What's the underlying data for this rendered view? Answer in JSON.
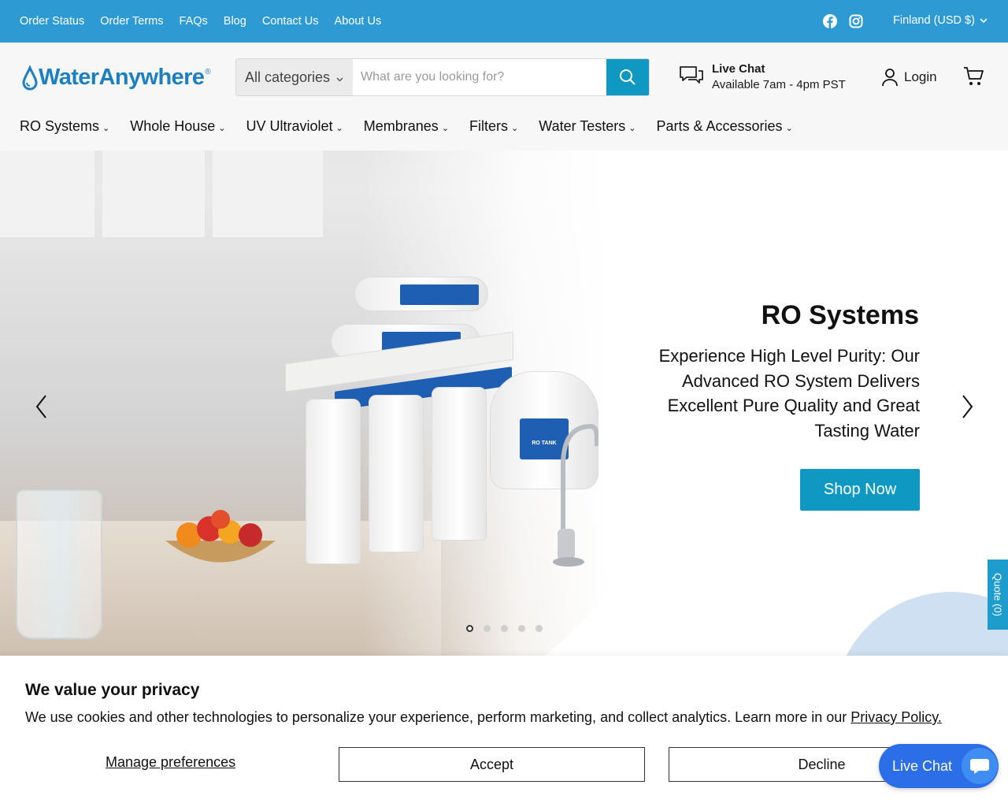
{
  "topbar": {
    "links": [
      "Order Status",
      "Order Terms",
      "FAQs",
      "Blog",
      "Contact Us",
      "About Us"
    ],
    "social_icons": [
      "facebook-icon",
      "instagram-icon"
    ],
    "region": "Finland (USD $)"
  },
  "header": {
    "logo_text": "WaterAnywhere",
    "logo_reg": "®",
    "search": {
      "category": "All categories",
      "placeholder": "What are you looking for?"
    },
    "live_chat": {
      "title": "Live Chat",
      "hours": "Available 7am - 4pm PST"
    },
    "login": "Login"
  },
  "nav": {
    "items": [
      "RO Systems",
      "Whole House",
      "UV Ultraviolet",
      "Membranes",
      "Filters",
      "Water Testers",
      "Parts & Accessories"
    ]
  },
  "hero": {
    "title": "RO Systems",
    "subtitle": "Experience High Level Purity: Our Advanced RO System Delivers Excellent Pure Quality and Great Tasting Water",
    "cta": "Shop Now",
    "slide_count": 5,
    "active_slide": 1,
    "tank_label": "RO TANK"
  },
  "quote_tab": "Quote (0)",
  "cookie": {
    "title": "We value your privacy",
    "text": "We use cookies and other technologies to personalize your experience, perform marketing, and collect analytics. Learn more in our ",
    "link": "Privacy Policy.",
    "manage": "Manage preferences",
    "accept": "Accept",
    "decline": "Decline"
  },
  "chat_widget": {
    "label": "Live Chat"
  },
  "colors": {
    "topbar": "#2d9ad4",
    "accent": "#0f98c2",
    "logo": "#1c7fc0",
    "chat": "#2c6ee8"
  }
}
